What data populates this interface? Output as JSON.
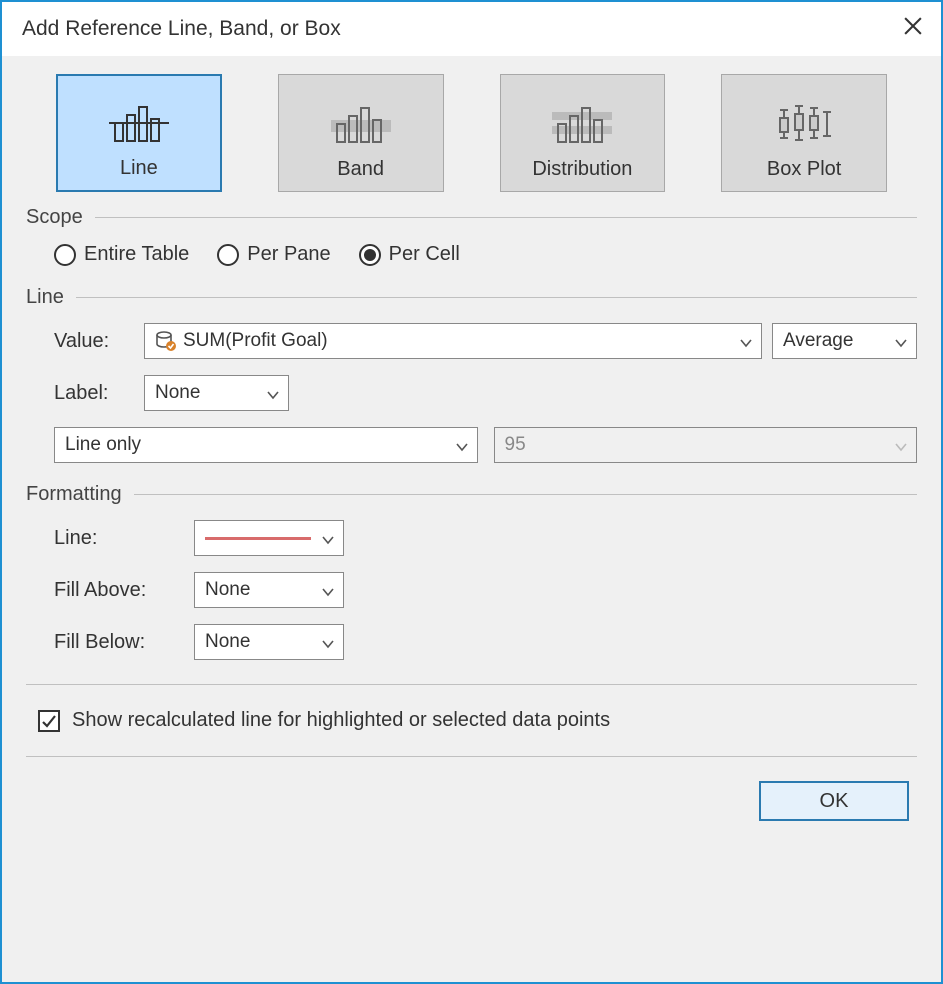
{
  "title": "Add Reference Line, Band, or Box",
  "tabs": {
    "line": "Line",
    "band": "Band",
    "distribution": "Distribution",
    "boxplot": "Box Plot"
  },
  "sections": {
    "scope": "Scope",
    "line": "Line",
    "formatting": "Formatting"
  },
  "scope": {
    "entire_table": "Entire Table",
    "per_pane": "Per Pane",
    "per_cell": "Per Cell"
  },
  "line": {
    "value_label": "Value:",
    "value_field": "SUM(Profit Goal)",
    "agg": "Average",
    "label_label": "Label:",
    "label_value": "None",
    "mode": "Line only",
    "percent": "95"
  },
  "formatting": {
    "line_label": "Line:",
    "fill_above_label": "Fill Above:",
    "fill_above_value": "None",
    "fill_below_label": "Fill Below:",
    "fill_below_value": "None"
  },
  "recalc_label": "Show recalculated line for highlighted or selected data points",
  "ok": "OK"
}
